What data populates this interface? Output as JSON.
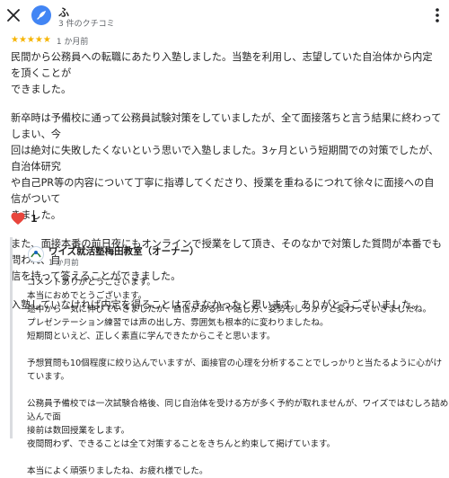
{
  "header": {
    "close_icon": "close-icon",
    "reviewer_name": "ふ",
    "reviewer_sub": "3 件のクチコミ",
    "more_icon": "more-vert-icon"
  },
  "rating": {
    "stars": 5,
    "stars_text": "★★★★★",
    "date": "1 か月前",
    "star_color": "#f6b400"
  },
  "review": {
    "paragraphs": [
      "民間から公務員への転職にあたり入塾しました。当塾を利用し、志望していた自治体から内定を頂くことが\nできました。",
      "新卒時は予備校に通って公務員試験対策をしていましたが、全て面接落ちと言う結果に終わってしまい、今\n回は絶対に失敗したくないという思いで入塾しました。3ヶ月という短期間での対策でしたが、自治体研究\nや自己PR等の内容について丁寧に指導してくださり、授業を重ねるにつれて徐々に面接への自信がついて\nきました。",
      "また、面接本番の前日夜にもオンラインで授業をして頂き、そのなかで対策した質問が本番でも問われ、自\n信を持って答えることができました。",
      "入塾していなければ内定を得ることはできなかったと思います。ありがとうございました。"
    ]
  },
  "reaction": {
    "icon": "heart-icon",
    "count": "1",
    "color": "#e8453c"
  },
  "owner_reply": {
    "name": "ワイズ就活塾梅田教室（オーナー）",
    "date": "1 か月前",
    "lines": [
      "コメントありがとうございます。",
      "本当におめでとうございます。",
      "途中から一気に伸びていきましたが、自信がある声や話し方、姿勢もしっかりと変わっていきましたね。",
      "プレゼンテーション練習では声の出し方、雰囲気も根本的に変わりましたね。",
      "短期間といえど、正しく素直に学んできたからこそと思います。",
      "",
      "予想質問も10個程度に絞り込んでいますが、面接官の心理を分析することでしっかりと当たるように心がけています。",
      "",
      "公務員予備校では一次試験合格後、同じ自治体を受ける方が多く予約が取れませんが、ワイズではむしろ詰め込んで面",
      "接前は数回授業をします。",
      "夜間問わず、できることは全て対策することをきちんと約束して掲げています。",
      "",
      "本当によく頑張りましたね、お疲れ様でした。"
    ]
  }
}
